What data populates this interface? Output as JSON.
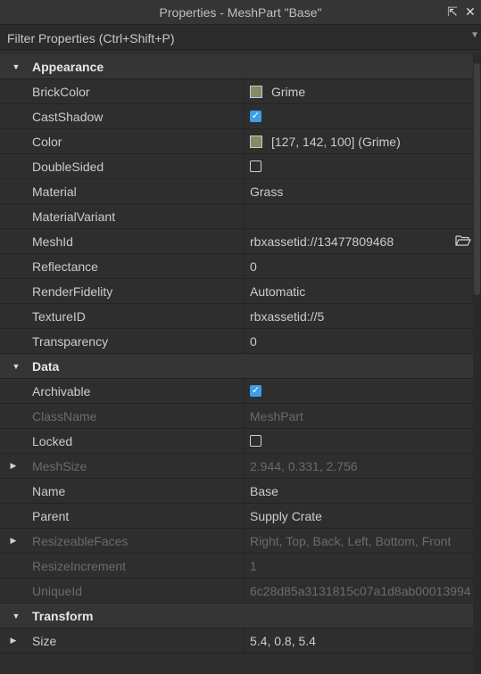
{
  "window": {
    "title": "Properties - MeshPart \"Base\""
  },
  "filter": {
    "placeholder": "Filter Properties (Ctrl+Shift+P)"
  },
  "colors": {
    "grime": "#7f8e64",
    "check": "#3c9ee6"
  },
  "sections": {
    "appearance": {
      "label": "Appearance",
      "rows": {
        "brickcolor": {
          "name": "BrickColor",
          "value": "Grime"
        },
        "castshadow": {
          "name": "CastShadow"
        },
        "color": {
          "name": "Color",
          "value": "[127, 142, 100] (Grime)"
        },
        "doublesided": {
          "name": "DoubleSided"
        },
        "material": {
          "name": "Material",
          "value": "Grass"
        },
        "materialvariant": {
          "name": "MaterialVariant",
          "value": ""
        },
        "meshid": {
          "name": "MeshId",
          "value": "rbxassetid://13477809468"
        },
        "reflectance": {
          "name": "Reflectance",
          "value": "0"
        },
        "renderfidelity": {
          "name": "RenderFidelity",
          "value": "Automatic"
        },
        "textureid": {
          "name": "TextureID",
          "value": "rbxassetid://5"
        },
        "transparency": {
          "name": "Transparency",
          "value": "0"
        }
      }
    },
    "data": {
      "label": "Data",
      "rows": {
        "archivable": {
          "name": "Archivable"
        },
        "classname": {
          "name": "ClassName",
          "value": "MeshPart"
        },
        "locked": {
          "name": "Locked"
        },
        "meshsize": {
          "name": "MeshSize",
          "value": "2.944, 0.331, 2.756"
        },
        "name": {
          "name": "Name",
          "value": "Base"
        },
        "parent": {
          "name": "Parent",
          "value": "Supply Crate"
        },
        "resizeablefaces": {
          "name": "ResizeableFaces",
          "value": "Right, Top, Back, Left, Bottom, Front"
        },
        "resizeincrement": {
          "name": "ResizeIncrement",
          "value": "1"
        },
        "uniqueid": {
          "name": "UniqueId",
          "value": "6c28d85a3131815c07a1d8ab00013994"
        }
      }
    },
    "transform": {
      "label": "Transform",
      "rows": {
        "size": {
          "name": "Size",
          "value": "5.4, 0.8, 5.4"
        }
      }
    }
  }
}
